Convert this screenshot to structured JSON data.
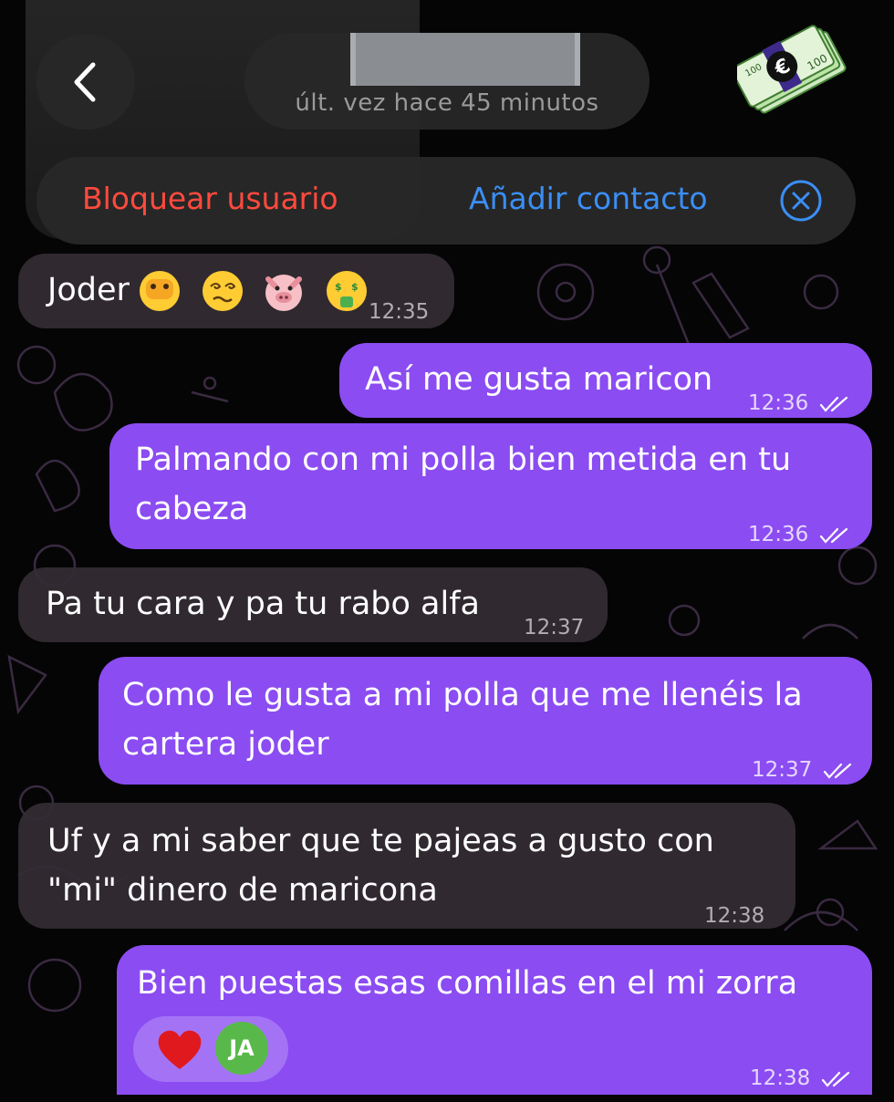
{
  "header": {
    "last_seen": "últ. vez hace 45 minutos",
    "back_icon": "chevron-left-icon",
    "avatar_icon": "money-euro-icon"
  },
  "action_bar": {
    "block_label": "Bloquear usuario",
    "add_contact_label": "Añadir contacto",
    "close_icon": "close-circle-icon"
  },
  "colors": {
    "outgoing_bubble": "#8b4cf2",
    "incoming_bubble": "#342c34",
    "block_red": "#ff4a3d",
    "link_blue": "#3b8ef5"
  },
  "messages": [
    {
      "direction": "in",
      "text": "Joder",
      "emojis": [
        "face-with-hand-over-mouth",
        "dizzy-face",
        "pig-face",
        "money-mouth-face"
      ],
      "time": "12:35"
    },
    {
      "direction": "out",
      "text": "Así me gusta maricon",
      "time": "12:36",
      "status": "read"
    },
    {
      "direction": "out",
      "lines": [
        "Palmando con mi polla bien metida en tu",
        "cabeza"
      ],
      "time": "12:36",
      "status": "read"
    },
    {
      "direction": "in",
      "text": "Pa tu cara y pa tu rabo alfa",
      "time": "12:37"
    },
    {
      "direction": "out",
      "lines": [
        "Como le gusta a mi polla que me llenéis la",
        "cartera joder"
      ],
      "time": "12:37",
      "status": "read"
    },
    {
      "direction": "in",
      "lines": [
        "Uf y a mi saber que te pajeas a gusto con",
        "\"mi\" dinero de maricona"
      ],
      "time": "12:38"
    },
    {
      "direction": "out",
      "text": "Bien puestas esas comillas en el mi zorra",
      "time": "12:38",
      "status": "read",
      "reaction": {
        "emoji": "red-heart",
        "reactor_initials": "JA"
      }
    }
  ]
}
